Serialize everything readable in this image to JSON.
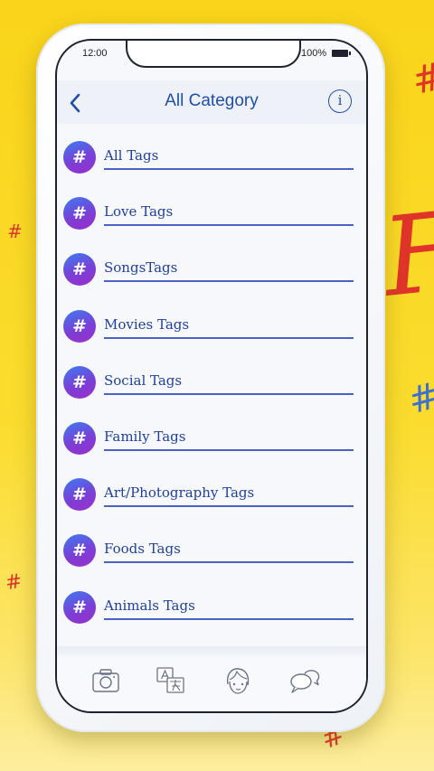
{
  "status_bar": {
    "time": "12:00",
    "battery": "100%"
  },
  "header": {
    "title": "All Category",
    "back_icon": "chevron-left-icon",
    "info_icon": "info-icon",
    "info_glyph": "i"
  },
  "categories": [
    {
      "label": "All Tags",
      "icon": "hashtag-icon",
      "glyph": "#"
    },
    {
      "label": "Love Tags",
      "icon": "hashtag-icon",
      "glyph": "#"
    },
    {
      "label": "SongsTags",
      "icon": "hashtag-icon",
      "glyph": "#"
    },
    {
      "label": "Movies Tags",
      "icon": "hashtag-icon",
      "glyph": "#"
    },
    {
      "label": "Social Tags",
      "icon": "hashtag-icon",
      "glyph": "#"
    },
    {
      "label": "Family Tags",
      "icon": "hashtag-icon",
      "glyph": "#"
    },
    {
      "label": "Art/Photography Tags",
      "icon": "hashtag-icon",
      "glyph": "#"
    },
    {
      "label": "Foods Tags",
      "icon": "hashtag-icon",
      "glyph": "#"
    },
    {
      "label": "Animals Tags",
      "icon": "hashtag-icon",
      "glyph": "#"
    }
  ],
  "tab_bar": [
    {
      "icon": "camera-icon"
    },
    {
      "icon": "translate-icon"
    },
    {
      "icon": "face-icon"
    },
    {
      "icon": "chat-icon"
    }
  ],
  "decorations": {
    "hash_glyph": "#",
    "partial_letters": "Fo"
  },
  "colors": {
    "accent": "#1f4fa8",
    "background": "#f9d41a",
    "badge_start": "#3b7df0",
    "badge_end": "#9a2fcb"
  }
}
